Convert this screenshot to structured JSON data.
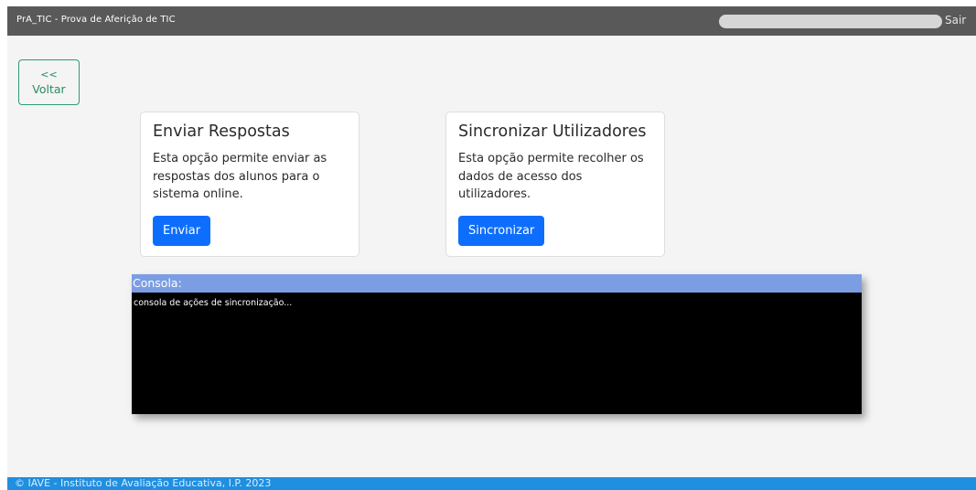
{
  "header": {
    "app_title": "PrA_TIC - Prova de Aferição de TIC",
    "logout_label": "Sair"
  },
  "back_button": {
    "arrows": "<<",
    "label": "Voltar"
  },
  "cards": [
    {
      "title": "Enviar Respostas",
      "description": "Esta opção permite enviar as respostas dos alunos para o sistema online.",
      "button_label": "Enviar"
    },
    {
      "title": "Sincronizar Utilizadores",
      "description": "Esta opção permite recolher os dados de acesso dos utilizadores.",
      "button_label": "Sincronizar"
    }
  ],
  "console": {
    "title": "Consola:",
    "placeholder": "consola de ações de sincronização..."
  },
  "footer": {
    "text": "© IAVE - Instituto de Avaliação Educativa, I.P. 2023"
  },
  "colors": {
    "topbar": "#595959",
    "primary": "#0d6efd",
    "back_border": "#2e9c6f",
    "console_header": "#7b9de3",
    "footer": "#1f8fe0"
  }
}
